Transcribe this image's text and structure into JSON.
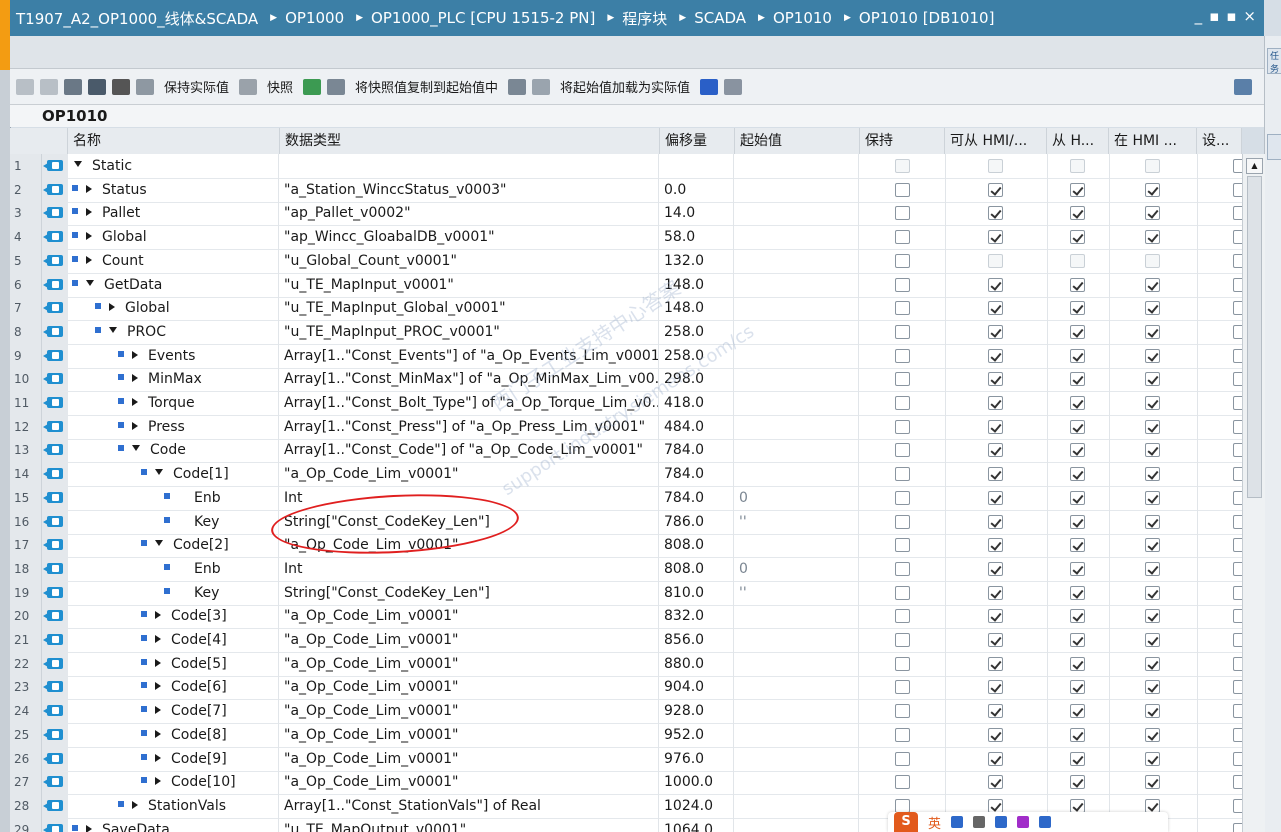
{
  "window": {
    "breadcrumb": [
      "T1907_A2_OP1000_线体&SCADA",
      "OP1000",
      "OP1000_PLC [CPU 1515-2 PN]",
      "程序块",
      "SCADA",
      "OP1010",
      "OP1010 [DB1010]"
    ],
    "controls": [
      "_",
      "▪",
      "▪",
      "×"
    ]
  },
  "toolbar": {
    "keep_actual": "保持实际值",
    "snapshot": "快照",
    "copy_snapshot": "将快照值复制到起始值中",
    "load_start": "将起始值加载为实际值"
  },
  "block_name": "OP1010",
  "columns": {
    "name": "名称",
    "datatype": "数据类型",
    "offset": "偏移量",
    "start": "起始值",
    "retain": "保持",
    "hmi_access": "可从 HMI/...",
    "from_h": "从 H...",
    "in_hmi": "在 HMI ...",
    "set": "设..."
  },
  "rows": [
    {
      "n": "1",
      "name": "Static",
      "dt": "",
      "off": "",
      "sv": "",
      "indent": 0,
      "bullet": false,
      "exp": "down",
      "chk": [
        false,
        false,
        false,
        false
      ],
      "dis": true
    },
    {
      "n": "2",
      "name": "Status",
      "dt": "\"a_Station_WinccStatus_v0003\"",
      "off": "0.0",
      "sv": "",
      "indent": 1,
      "bullet": true,
      "exp": "right",
      "chk": [
        false,
        true,
        true,
        true
      ]
    },
    {
      "n": "3",
      "name": "Pallet",
      "dt": "\"ap_Pallet_v0002\"",
      "off": "14.0",
      "sv": "",
      "indent": 1,
      "bullet": true,
      "exp": "right",
      "chk": [
        false,
        true,
        true,
        true
      ]
    },
    {
      "n": "4",
      "name": "Global",
      "dt": "\"ap_Wincc_GloabalDB_v0001\"",
      "off": "58.0",
      "sv": "",
      "indent": 1,
      "bullet": true,
      "exp": "right",
      "chk": [
        false,
        true,
        true,
        true
      ]
    },
    {
      "n": "5",
      "name": "Count",
      "dt": "\"u_Global_Count_v0001\"",
      "off": "132.0",
      "sv": "",
      "indent": 1,
      "bullet": true,
      "exp": "right",
      "chk": [
        false,
        false,
        false,
        false
      ],
      "disx": true
    },
    {
      "n": "6",
      "name": "GetData",
      "dt": "\"u_TE_MapInput_v0001\"",
      "off": "148.0",
      "sv": "",
      "indent": 1,
      "bullet": true,
      "exp": "down",
      "chk": [
        false,
        true,
        true,
        true
      ]
    },
    {
      "n": "7",
      "name": "Global",
      "dt": "\"u_TE_MapInput_Global_v0001\"",
      "off": "148.0",
      "sv": "",
      "indent": 2,
      "bullet": true,
      "exp": "right",
      "chk": [
        false,
        true,
        true,
        true
      ]
    },
    {
      "n": "8",
      "name": "PROC",
      "dt": "\"u_TE_MapInput_PROC_v0001\"",
      "off": "258.0",
      "sv": "",
      "indent": 2,
      "bullet": true,
      "exp": "down",
      "chk": [
        false,
        true,
        true,
        true
      ]
    },
    {
      "n": "9",
      "name": "Events",
      "dt": "Array[1..\"Const_Events\"] of \"a_Op_Events_Lim_v0001\"",
      "off": "258.0",
      "sv": "",
      "indent": 3,
      "bullet": true,
      "exp": "right",
      "chk": [
        false,
        true,
        true,
        true
      ]
    },
    {
      "n": "10",
      "name": "MinMax",
      "dt": "Array[1..\"Const_MinMax\"] of \"a_Op_MinMax_Lim_v00...",
      "off": "298.0",
      "sv": "",
      "indent": 3,
      "bullet": true,
      "exp": "right",
      "chk": [
        false,
        true,
        true,
        true
      ]
    },
    {
      "n": "11",
      "name": "Torque",
      "dt": "Array[1..\"Const_Bolt_Type\"] of \"a_Op_Torque_Lim_v0...",
      "off": "418.0",
      "sv": "",
      "indent": 3,
      "bullet": true,
      "exp": "right",
      "chk": [
        false,
        true,
        true,
        true
      ]
    },
    {
      "n": "12",
      "name": "Press",
      "dt": "Array[1..\"Const_Press\"] of \"a_Op_Press_Lim_v0001\"",
      "off": "484.0",
      "sv": "",
      "indent": 3,
      "bullet": true,
      "exp": "right",
      "chk": [
        false,
        true,
        true,
        true
      ]
    },
    {
      "n": "13",
      "name": "Code",
      "dt": "Array[1..\"Const_Code\"] of \"a_Op_Code_Lim_v0001\"",
      "off": "784.0",
      "sv": "",
      "indent": 3,
      "bullet": true,
      "exp": "down",
      "chk": [
        false,
        true,
        true,
        true
      ]
    },
    {
      "n": "14",
      "name": "Code[1]",
      "dt": "\"a_Op_Code_Lim_v0001\"",
      "off": "784.0",
      "sv": "",
      "indent": 4,
      "bullet": true,
      "exp": "down",
      "chk": [
        false,
        true,
        true,
        true
      ]
    },
    {
      "n": "15",
      "name": "Enb",
      "dt": "Int",
      "off": "784.0",
      "sv": "0",
      "indent": 5,
      "bullet": true,
      "exp": "none",
      "chk": [
        false,
        true,
        true,
        true
      ]
    },
    {
      "n": "16",
      "name": "Key",
      "dt": "String[\"Const_CodeKey_Len\"]",
      "off": "786.0",
      "sv": "''",
      "indent": 5,
      "bullet": true,
      "exp": "none",
      "chk": [
        false,
        true,
        true,
        true
      ]
    },
    {
      "n": "17",
      "name": "Code[2]",
      "dt": "\"a_Op_Code_Lim_v0001\"",
      "off": "808.0",
      "sv": "",
      "indent": 4,
      "bullet": true,
      "exp": "down",
      "chk": [
        false,
        true,
        true,
        true
      ]
    },
    {
      "n": "18",
      "name": "Enb",
      "dt": "Int",
      "off": "808.0",
      "sv": "0",
      "indent": 5,
      "bullet": true,
      "exp": "none",
      "chk": [
        false,
        true,
        true,
        true
      ]
    },
    {
      "n": "19",
      "name": "Key",
      "dt": "String[\"Const_CodeKey_Len\"]",
      "off": "810.0",
      "sv": "''",
      "indent": 5,
      "bullet": true,
      "exp": "none",
      "chk": [
        false,
        true,
        true,
        true
      ]
    },
    {
      "n": "20",
      "name": "Code[3]",
      "dt": "\"a_Op_Code_Lim_v0001\"",
      "off": "832.0",
      "sv": "",
      "indent": 4,
      "bullet": true,
      "exp": "right",
      "chk": [
        false,
        true,
        true,
        true
      ]
    },
    {
      "n": "21",
      "name": "Code[4]",
      "dt": "\"a_Op_Code_Lim_v0001\"",
      "off": "856.0",
      "sv": "",
      "indent": 4,
      "bullet": true,
      "exp": "right",
      "chk": [
        false,
        true,
        true,
        true
      ]
    },
    {
      "n": "22",
      "name": "Code[5]",
      "dt": "\"a_Op_Code_Lim_v0001\"",
      "off": "880.0",
      "sv": "",
      "indent": 4,
      "bullet": true,
      "exp": "right",
      "chk": [
        false,
        true,
        true,
        true
      ]
    },
    {
      "n": "23",
      "name": "Code[6]",
      "dt": "\"a_Op_Code_Lim_v0001\"",
      "off": "904.0",
      "sv": "",
      "indent": 4,
      "bullet": true,
      "exp": "right",
      "chk": [
        false,
        true,
        true,
        true
      ]
    },
    {
      "n": "24",
      "name": "Code[7]",
      "dt": "\"a_Op_Code_Lim_v0001\"",
      "off": "928.0",
      "sv": "",
      "indent": 4,
      "bullet": true,
      "exp": "right",
      "chk": [
        false,
        true,
        true,
        true
      ]
    },
    {
      "n": "25",
      "name": "Code[8]",
      "dt": "\"a_Op_Code_Lim_v0001\"",
      "off": "952.0",
      "sv": "",
      "indent": 4,
      "bullet": true,
      "exp": "right",
      "chk": [
        false,
        true,
        true,
        true
      ]
    },
    {
      "n": "26",
      "name": "Code[9]",
      "dt": "\"a_Op_Code_Lim_v0001\"",
      "off": "976.0",
      "sv": "",
      "indent": 4,
      "bullet": true,
      "exp": "right",
      "chk": [
        false,
        true,
        true,
        true
      ]
    },
    {
      "n": "27",
      "name": "Code[10]",
      "dt": "\"a_Op_Code_Lim_v0001\"",
      "off": "1000.0",
      "sv": "",
      "indent": 4,
      "bullet": true,
      "exp": "right",
      "chk": [
        false,
        true,
        true,
        true
      ]
    },
    {
      "n": "28",
      "name": "StationVals",
      "dt": "Array[1..\"Const_StationVals\"] of Real",
      "off": "1024.0",
      "sv": "",
      "indent": 3,
      "bullet": true,
      "exp": "right",
      "chk": [
        false,
        true,
        true,
        true
      ]
    },
    {
      "n": "29",
      "name": "SaveData",
      "dt": "\"u_TE_MapOutput_v0001\"",
      "off": "1064.0",
      "sv": "",
      "indent": 1,
      "bullet": true,
      "exp": "right",
      "chk": [
        false,
        true,
        true,
        true
      ]
    }
  ],
  "watermark": {
    "line1": "西门子工业支持中心答案",
    "line2": "support.industry.siemens.com/cs"
  },
  "ime": {
    "logo": "S",
    "lang": "英"
  },
  "right_tabs": [
    "任务"
  ]
}
